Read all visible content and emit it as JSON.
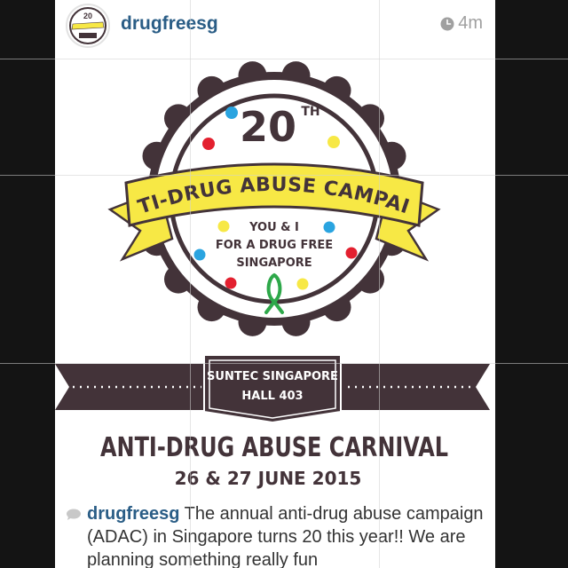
{
  "post": {
    "username": "drugfreesg",
    "time": "4m",
    "avatar_text": "20",
    "clock_icon": "clock-icon"
  },
  "poster": {
    "number": "20",
    "superscript": "TH",
    "banner": "ANTI-DRUG ABUSE CAMPAIGN",
    "tagline": [
      "YOU & I",
      "FOR A DRUG FREE",
      "SINGAPORE"
    ],
    "venue": [
      "SUNTEC SINGAPORE",
      "HALL 403"
    ],
    "event_title": "ANTI-DRUG ABUSE CARNIVAL",
    "event_dates": "26 & 27 JUNE 2015",
    "colors": {
      "dark": "#433339",
      "yellow": "#f7e845",
      "blue": "#2aa4e0",
      "red": "#e3202f",
      "green": "#2ea84a"
    }
  },
  "caption": {
    "username": "drugfreesg",
    "text": " The annual anti-drug abuse campaign (ADAC)  in Singapore turns 20 this year!! We are planning something really fun"
  }
}
